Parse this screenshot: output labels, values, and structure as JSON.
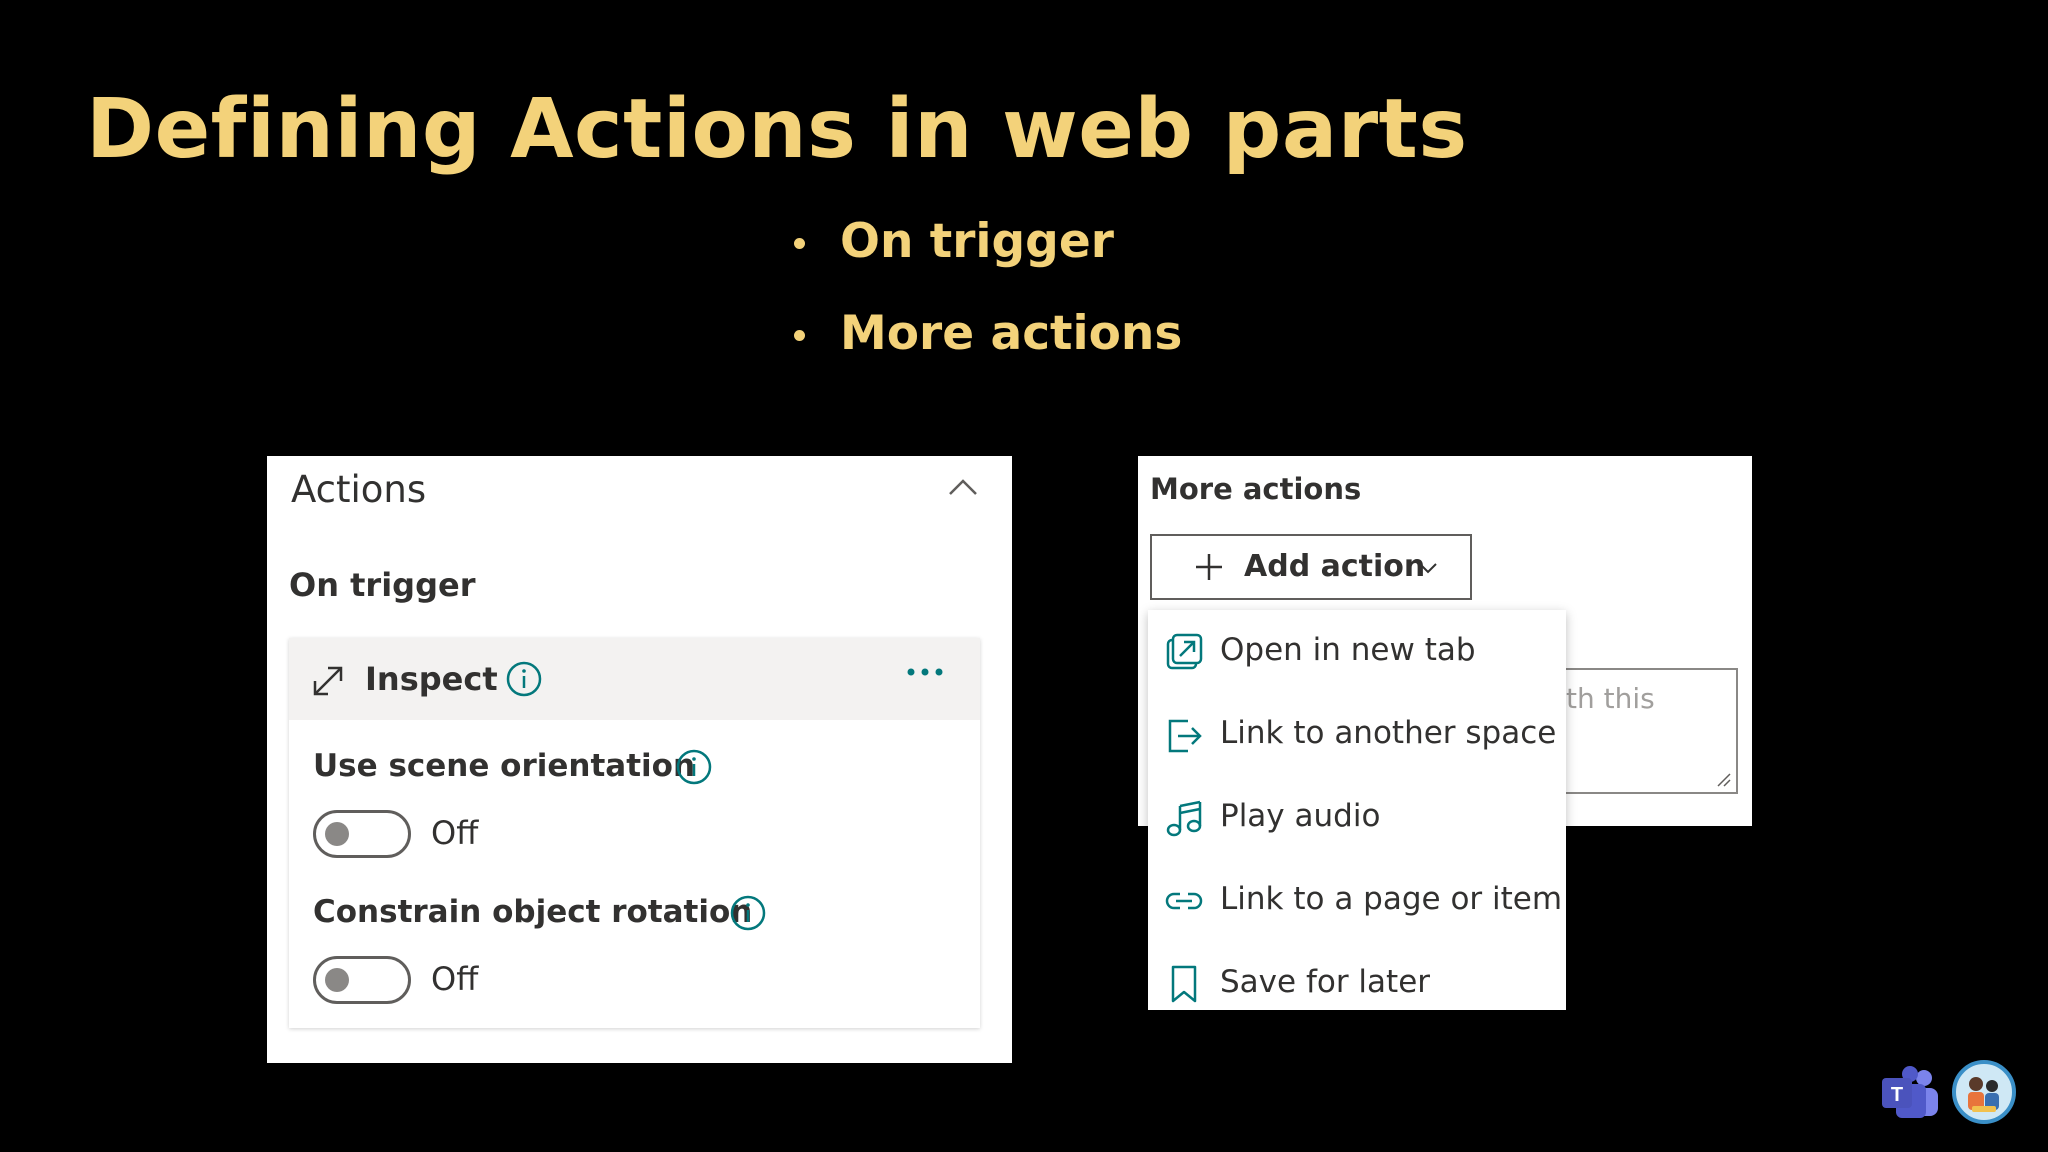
{
  "slide": {
    "title": "Defining Actions in web parts",
    "bullets": [
      "On trigger",
      "More actions"
    ]
  },
  "actions_panel": {
    "header": "Actions",
    "section_label": "On trigger",
    "card": {
      "action_label": "Inspect",
      "settings": [
        {
          "label": "Use scene orientation",
          "toggle_state": "Off",
          "on": false
        },
        {
          "label": "Constrain object rotation",
          "toggle_state": "Off",
          "on": false
        }
      ]
    }
  },
  "more_actions_panel": {
    "header": "More actions",
    "add_button_label": "Add action",
    "description_hint_partial": "th this",
    "dropdown_items": [
      {
        "label": "Open in new tab",
        "icon": "open-in-new-tab-icon"
      },
      {
        "label": "Link to another space",
        "icon": "link-to-space-icon"
      },
      {
        "label": "Play audio",
        "icon": "music-note-icon"
      },
      {
        "label": "Link to a page or item",
        "icon": "link-icon"
      },
      {
        "label": "Save for later",
        "icon": "bookmark-icon"
      }
    ]
  },
  "colors": {
    "title_accent": "#f3d27a",
    "teal_accent": "#03787c",
    "background": "#000000"
  }
}
